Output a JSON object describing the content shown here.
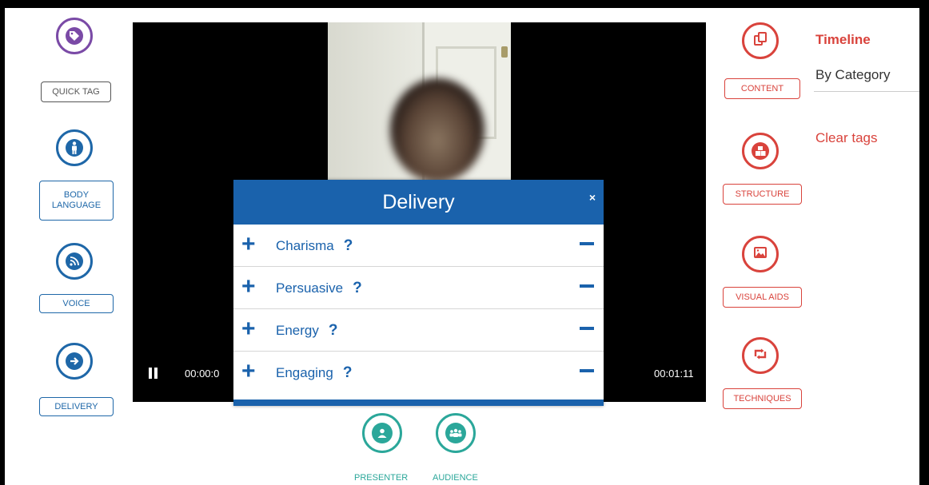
{
  "left_tools": [
    {
      "label": "QUICK TAG",
      "icon": "tag-icon"
    },
    {
      "label": "BODY LANGUAGE",
      "icon": "person-icon"
    },
    {
      "label": "VOICE",
      "icon": "voice-icon"
    },
    {
      "label": "DELIVERY",
      "icon": "arrow-right-icon"
    }
  ],
  "right_tools": [
    {
      "label": "CONTENT",
      "icon": "copy-icon"
    },
    {
      "label": "STRUCTURE",
      "icon": "cubes-icon"
    },
    {
      "label": "VISUAL AIDS",
      "icon": "image-icon"
    },
    {
      "label": "TECHNIQUES",
      "icon": "retweet-icon"
    }
  ],
  "video": {
    "elapsed": "00:00:0",
    "duration": "00:01:11",
    "pause_icon": "pause-icon"
  },
  "modal": {
    "title": "Delivery",
    "close": "×",
    "items": [
      {
        "label": "Charisma",
        "help": "?"
      },
      {
        "label": "Persuasive",
        "help": "?"
      },
      {
        "label": "Energy",
        "help": "?"
      },
      {
        "label": "Engaging",
        "help": "?"
      }
    ]
  },
  "bottom_buttons": [
    {
      "label": "PRESENTER",
      "icon": "user-icon"
    },
    {
      "label": "AUDIENCE",
      "icon": "group-icon"
    }
  ],
  "side_panel": {
    "timeline": "Timeline",
    "by_category": "By Category",
    "clear_tags": "Clear tags"
  },
  "colors": {
    "left_accent": "#1e67a8",
    "right_accent": "#d9433c",
    "modal_header": "#1a62ac",
    "teal": "#2ba79a",
    "tag_purple": "#7a4aa6"
  }
}
